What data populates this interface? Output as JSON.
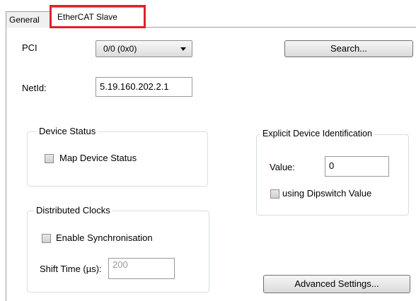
{
  "tabs": [
    {
      "label": "General"
    },
    {
      "label": "EtherCAT Slave",
      "active": true
    }
  ],
  "highlight_color": "#e0212b",
  "pci": {
    "label": "PCI",
    "selected": "0/0 (0x0)"
  },
  "search_button": {
    "label": "Search..."
  },
  "netid": {
    "label": "NetId:",
    "value": "5.19.160.202.2.1"
  },
  "device_status": {
    "title": "Device Status",
    "map_device_status": {
      "label": "Map Device Status",
      "checked": false
    }
  },
  "explicit_id": {
    "title": "Explicit Device Identification",
    "value_label": "Value:",
    "value": "0",
    "dipswitch": {
      "label": "using Dipswitch Value",
      "checked": false
    }
  },
  "distributed_clocks": {
    "title": "Distributed Clocks",
    "enable_sync": {
      "label": "Enable Synchronisation",
      "checked": false
    },
    "shift_time_label": "Shift Time (µs):",
    "shift_time_value": "200"
  },
  "advanced_button": {
    "label": "Advanced Settings..."
  }
}
